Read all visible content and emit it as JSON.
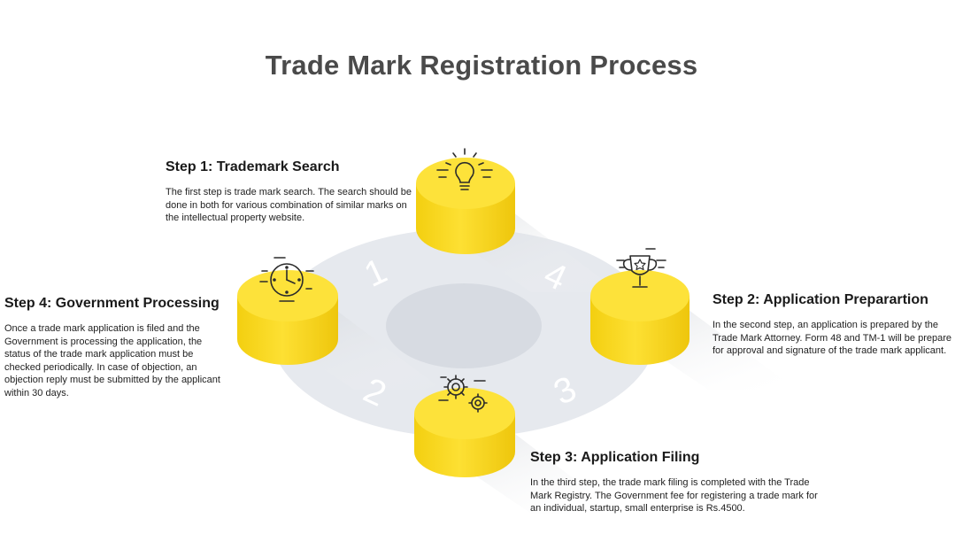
{
  "title": "Trade Mark Registration Process",
  "steps": [
    {
      "title": "Step 1: Trademark Search",
      "text": "The first step is trade mark search. The search should be done in both for various combination of similar marks on the intellectual property website.",
      "icon": "lightbulb-icon",
      "number": "1"
    },
    {
      "title": "Step 2: Application Preparartion",
      "text": "In the second step, an application is prepared by the Trade Mark Attorney. Form 48 and TM-1 will be prepare for approval and signature of the trade mark applicant.",
      "icon": "trophy-icon",
      "number": "4"
    },
    {
      "title": "Step 3: Application Filing",
      "text": "In the third step, the trade mark filing is completed with the Trade Mark Registry. The Government fee for registering a trade mark for an individual, startup, small enterprise is Rs.4500.",
      "icon": "gears-icon",
      "number": "3"
    },
    {
      "title": "Step 4: Government Processing",
      "text": "Once a trade mark application is filed and the Government is processing the application, the status of the trade mark application must be checked periodically. In case of objection, an objection reply must be submitted by the applicant within 30 days.",
      "icon": "clock-icon",
      "number": "2"
    }
  ],
  "colors": {
    "cylinder_top": "#fde23a",
    "cylinder_side": "#f2cd12",
    "ring": "#e4e7ec",
    "ring_inner": "#d6dae1",
    "ring_number": "#ffffff",
    "title": "#4a4a4a"
  }
}
